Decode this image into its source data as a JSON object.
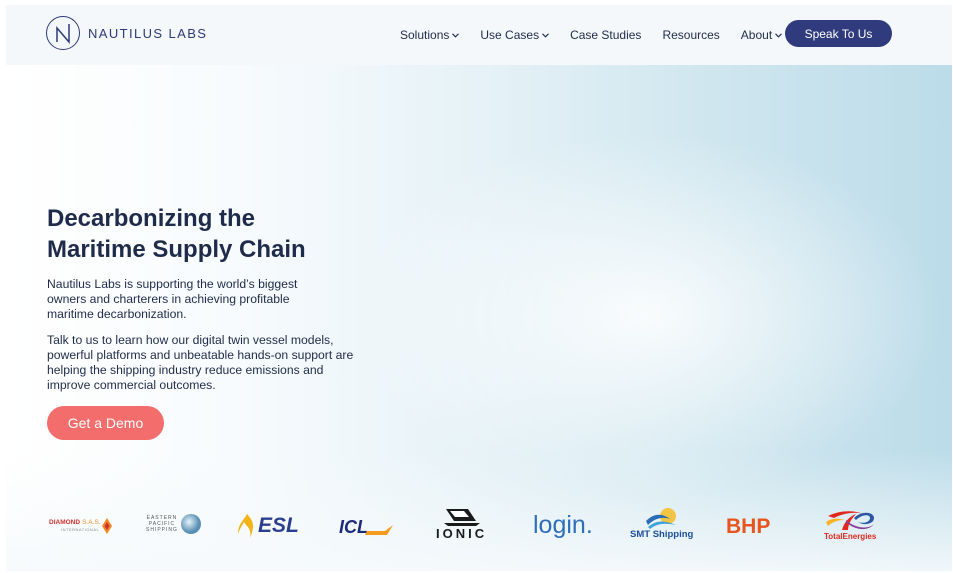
{
  "brand": {
    "name": "NAUTILUS LABS",
    "logo_icon": "nautilus-n-circle-icon",
    "color": "#2e3a78"
  },
  "nav": {
    "items": [
      {
        "label": "Solutions",
        "dropdown": true
      },
      {
        "label": "Use Cases",
        "dropdown": true
      },
      {
        "label": "Case Studies",
        "dropdown": false
      },
      {
        "label": "Resources",
        "dropdown": false
      },
      {
        "label": "About",
        "dropdown": true
      }
    ],
    "cta_label": "Speak To Us",
    "cta_color": "#2f3b7c"
  },
  "hero": {
    "headline_line1": "Decarbonizing the",
    "headline_line2": "Maritime Supply Chain",
    "paragraph1": "Nautilus Labs is supporting the world’s biggest owners and charterers in achieving profitable maritime decarbonization.",
    "paragraph2": "Talk to us to learn how our digital twin vessel models, powerful platforms and unbeatable hands-on support are helping the shipping industry reduce emissions and improve commercial outcomes.",
    "demo_label": "Get a Demo",
    "demo_color": "#f26d6b"
  },
  "partners": {
    "diamond": {
      "line1": "DIAMOND",
      "line2": "S.A.S.",
      "line3": "INTERNATIONAL"
    },
    "eastern": {
      "line1": "EASTERN",
      "line2": "PACIFIC",
      "line3": "SHIPPING"
    },
    "esl": {
      "text": "ESL"
    },
    "icl": {
      "text": "ICL"
    },
    "ionic": {
      "text": "IONIC"
    },
    "login": {
      "text_a": "log",
      "text_b": "in."
    },
    "smt": {
      "text": "SMT Shipping"
    },
    "bhp": {
      "text": "BHP"
    },
    "total": {
      "text": "TotalEnergies"
    }
  }
}
